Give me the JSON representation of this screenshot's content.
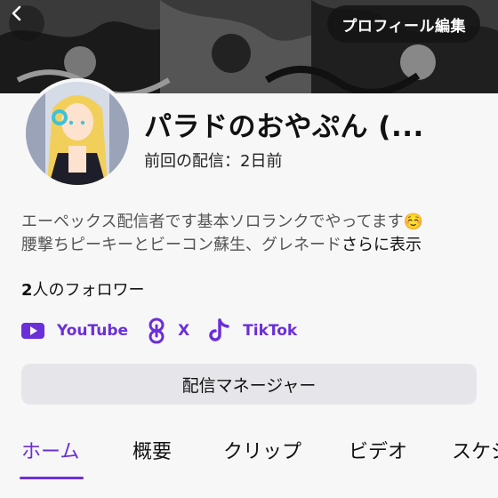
{
  "header": {
    "edit_profile_label": "プロフィール編集"
  },
  "profile": {
    "name": "パラドのおやぷん (...",
    "last_stream": "前回の配信：2日前",
    "bio_line1": "エーペックス配信者です基本ソロランクでやってます☺️",
    "bio_line2": "腰撃ちピーキーとビーコン蘇生、グレネード",
    "bio_more": "さらに表示",
    "followers_count": "2",
    "followers_suffix": "人のフォロワー"
  },
  "socials": [
    {
      "label": "YouTube",
      "icon": "youtube-icon"
    },
    {
      "label": "X",
      "icon": "link-icon"
    },
    {
      "label": "TikTok",
      "icon": "tiktok-icon"
    }
  ],
  "manager_button": "配信マネージャー",
  "tabs": [
    {
      "label": "ホーム",
      "active": true
    },
    {
      "label": "概要",
      "active": false
    },
    {
      "label": "クリップ",
      "active": false
    },
    {
      "label": "ビデオ",
      "active": false
    },
    {
      "label": "スケジ",
      "active": false
    }
  ],
  "colors": {
    "accent": "#6b2fd9",
    "button_bg": "#e6e6ea",
    "background": "#f7f7f8"
  }
}
